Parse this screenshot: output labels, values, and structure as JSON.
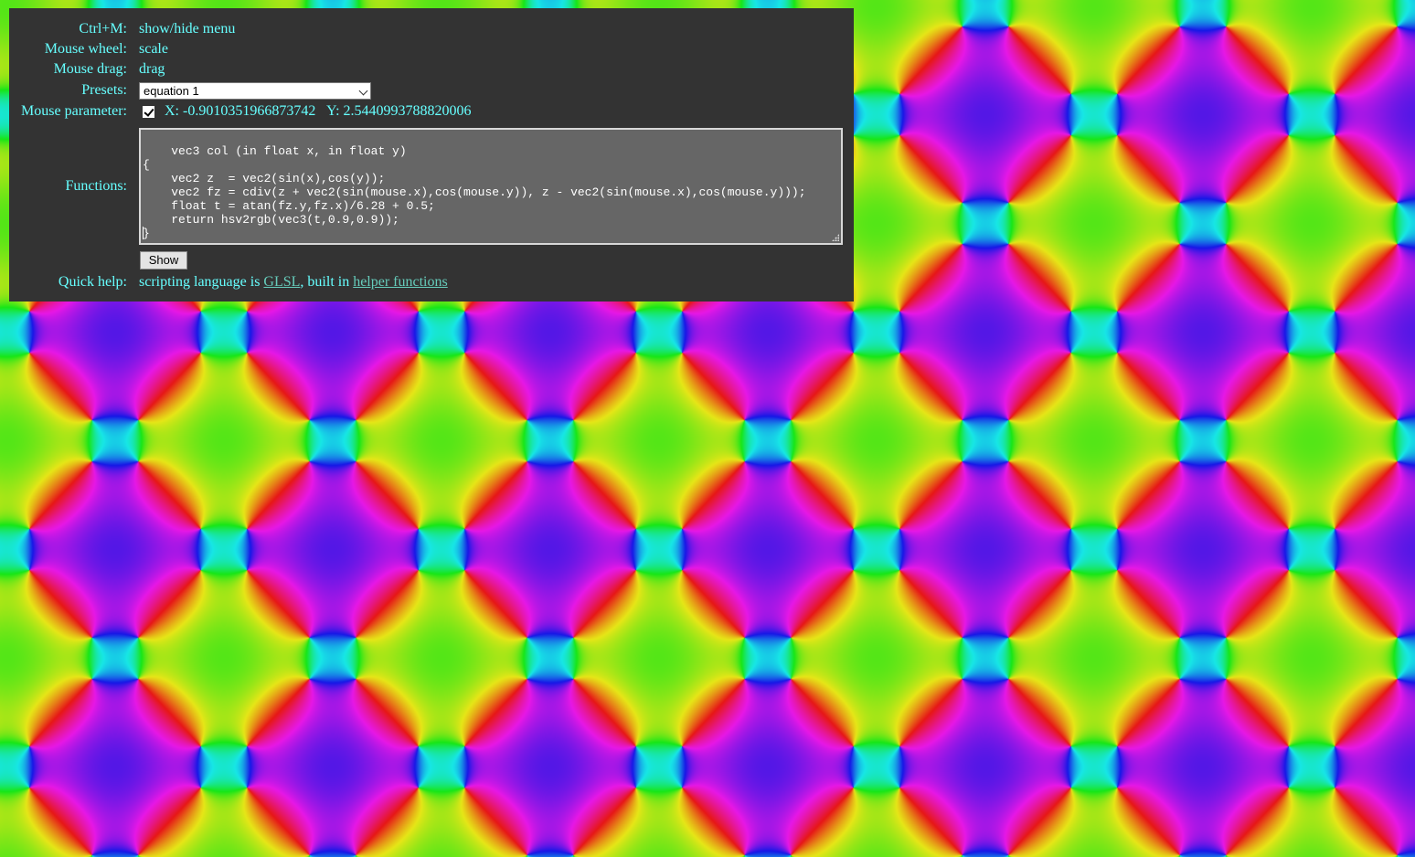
{
  "menu": {
    "shortcut_label": "Ctrl+M:",
    "shortcut_value": "show/hide menu",
    "wheel_label": "Mouse wheel:",
    "wheel_value": "scale",
    "drag_label": "Mouse drag:",
    "drag_value": "drag",
    "presets_label": "Presets:",
    "presets_selected": "equation 1",
    "mouse_param_label": "Mouse parameter:",
    "mouse_param_checked": true,
    "mouse_x": "X: -0.9010351966873742",
    "mouse_y": "Y: 2.5440993788820006",
    "functions_label": "Functions:",
    "functions_code": "vec3 col (in float x, in float y)\n{\n    vec2 z  = vec2(sin(x),cos(y));\n    vec2 fz = cdiv(z + vec2(sin(mouse.x),cos(mouse.y)), z - vec2(sin(mouse.x),cos(mouse.y)));\n    float t = atan(fz.y,fz.x)/6.28 + 0.5;\n    return hsv2rgb(vec3(t,0.9,0.9));\n}\n",
    "show_button": "Show",
    "quick_help_label": "Quick help:",
    "quick_help_text_1": "scripting language is ",
    "quick_help_link_1": "GLSL",
    "quick_help_text_2": ", built in ",
    "quick_help_link_2": "helper functions"
  },
  "colors": {
    "panel_bg": "#333333",
    "panel_text": "#66ffff",
    "link": "#66ccbb",
    "code_bg": "#666666"
  },
  "icons": {
    "select_arrow": "chevron-down-icon",
    "checkbox_mark": "checkmark-icon",
    "resize_grip": "resize-grip-icon"
  }
}
